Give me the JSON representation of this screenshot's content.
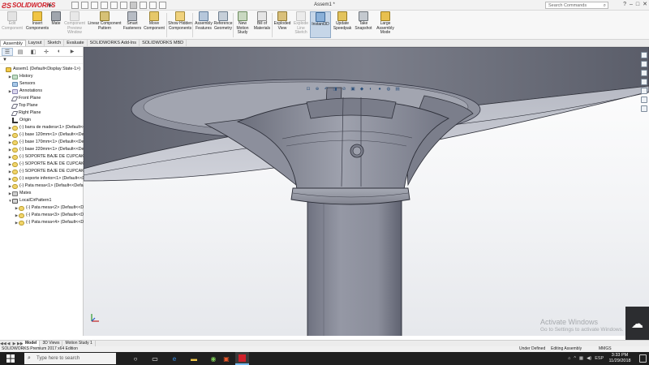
{
  "titlebar": {
    "app_name": "SOLIDWORKS",
    "document_title": "Assem1 *",
    "search_placeholder": "Search Commands",
    "min_glyph": "–",
    "max_glyph": "□",
    "close_glyph": "✕",
    "help_glyph": "?"
  },
  "ribbon": {
    "buttons": [
      {
        "label": "Edit Component",
        "state": "disabled"
      },
      {
        "label": "Insert Components",
        "state": "normal"
      },
      {
        "label": "Mate",
        "state": "normal"
      },
      {
        "label": "Component Preview Window",
        "state": "disabled"
      },
      {
        "label": "Linear Component Pattern",
        "state": "normal"
      },
      {
        "label": "Smart Fasteners",
        "state": "normal"
      },
      {
        "label": "Move Component",
        "state": "normal"
      },
      {
        "label": "Show Hidden Components",
        "state": "normal"
      },
      {
        "label": "Assembly Features",
        "state": "normal"
      },
      {
        "label": "Reference Geometry",
        "state": "normal"
      },
      {
        "label": "New Motion Study",
        "state": "normal"
      },
      {
        "label": "Bill of Materials",
        "state": "normal"
      },
      {
        "label": "Exploded View",
        "state": "normal"
      },
      {
        "label": "Explode Line Sketch",
        "state": "disabled"
      },
      {
        "label": "Instant3D",
        "state": "active"
      },
      {
        "label": "Update Speedpak",
        "state": "normal"
      },
      {
        "label": "Take Snapshot",
        "state": "normal"
      },
      {
        "label": "Large Assembly Mode",
        "state": "normal"
      }
    ]
  },
  "command_tabs": [
    "Assembly",
    "Layout",
    "Sketch",
    "Evaluate",
    "SOLIDWORKS Add-Ins",
    "SOLIDWORKS MBD"
  ],
  "command_tab_selected": "Assembly",
  "feature_tree": [
    {
      "label": "Assem1  (Default<Display State-1>)",
      "icon": "asm",
      "expand": "",
      "indent": 0
    },
    {
      "label": "History",
      "icon": "history",
      "expand": "▶",
      "indent": 1
    },
    {
      "label": "Sensors",
      "icon": "sensor",
      "expand": "",
      "indent": 1
    },
    {
      "label": "Annotations",
      "icon": "annot",
      "expand": "▶",
      "indent": 1
    },
    {
      "label": "Front Plane",
      "icon": "plane",
      "expand": "",
      "indent": 1
    },
    {
      "label": "Top Plane",
      "icon": "plane",
      "expand": "",
      "indent": 1
    },
    {
      "label": "Right Plane",
      "icon": "plane",
      "expand": "",
      "indent": 1
    },
    {
      "label": "Origin",
      "icon": "origin",
      "expand": "",
      "indent": 1
    },
    {
      "label": "(-) barra de madera<1> (Default<<Defa",
      "icon": "part",
      "expand": "▶",
      "indent": 1
    },
    {
      "label": "(-) base 120mm<1> (Default<<Default>",
      "icon": "part",
      "expand": "▶",
      "indent": 1
    },
    {
      "label": "(-) base 170mm<1> (Default<<Default>",
      "icon": "part",
      "expand": "▶",
      "indent": 1
    },
    {
      "label": "(-) base 220mm<1> (Default<<Default>",
      "icon": "part",
      "expand": "▶",
      "indent": 1
    },
    {
      "label": "(-) SOPORTE BAJE DE CUPCAKES<1>",
      "icon": "part",
      "expand": "▶",
      "indent": 1
    },
    {
      "label": "(-) SOPORTE BAJE DE CUPCAKES<2>",
      "icon": "part",
      "expand": "▶",
      "indent": 1
    },
    {
      "label": "(-) SOPORTE BAJE DE CUPCAKES<3>",
      "icon": "part",
      "expand": "▶",
      "indent": 1
    },
    {
      "label": "(-) soporte inferior<1> (Default<<D",
      "icon": "part",
      "expand": "▶",
      "indent": 1
    },
    {
      "label": "(-) Pata mesa<1> (Default<<Default",
      "icon": "part",
      "expand": "▶",
      "indent": 1
    },
    {
      "label": "Mates",
      "icon": "mates",
      "expand": "▶",
      "indent": 1
    },
    {
      "label": "LocalCirPattern1",
      "icon": "pattern",
      "expand": "▼",
      "indent": 1
    },
    {
      "label": "(-) Pata mesa<2> (Default<<De",
      "icon": "part",
      "expand": "▶",
      "indent": 2
    },
    {
      "label": "(-) Pata mesa<3> (Default<<De",
      "icon": "part",
      "expand": "▶",
      "indent": 2
    },
    {
      "label": "(-) Pata mesa<4> (Default<<De",
      "icon": "part",
      "expand": "▶",
      "indent": 2
    }
  ],
  "bottom_tabs": [
    "Model",
    "3D Views",
    "Motion Study 1"
  ],
  "bottom_tab_selected": "Model",
  "status": {
    "left": "SOLIDWORKS Premium 2017 x64 Edition",
    "under_defined": "Under Defined",
    "editing": "Editing Assembly",
    "units": "MMGS"
  },
  "watermark": {
    "line1": "Activate Windows",
    "line2": "Go to Settings to activate Windows."
  },
  "taskbar": {
    "search_placeholder": "Type here to search",
    "lang": "ESP",
    "time": "3:33 PM",
    "date": "11/29/2018"
  },
  "colors": {
    "model_shade": "#9a9daa",
    "model_dark": "#4b4d58",
    "brand_red": "#d0202a",
    "taskbar_bg": "#1f1f1f"
  }
}
